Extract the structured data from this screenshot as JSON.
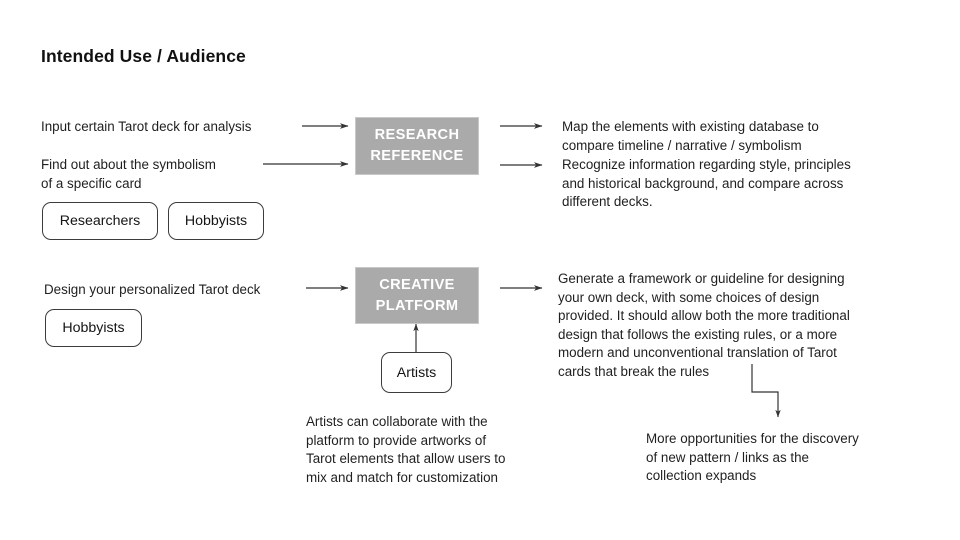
{
  "page": {
    "title": "Intended Use / Audience",
    "background_color": "#ffffff",
    "text_color": "#1f1f1f",
    "box_fill_color": "#aaaaaa",
    "box_border_color": "#c9c9c9",
    "box_text_color": "#ffffff",
    "connector_color": "#333333"
  },
  "flows": [
    {
      "id": "research-reference",
      "inputs": [
        {
          "id": "input-1",
          "text": "Input certain Tarot deck for analysis"
        },
        {
          "id": "input-2",
          "text": "Find out about the symbolism\nof a specific card"
        }
      ],
      "actors": [
        {
          "id": "actor-researchers",
          "label": "Researchers"
        },
        {
          "id": "actor-hobbyists",
          "label": "Hobbyists"
        }
      ],
      "process": {
        "id": "process-research-reference",
        "label": "RESEARCH\nREFERENCE"
      },
      "outputs": [
        {
          "id": "output-1",
          "text": "Map the elements with existing database to\ncompare timeline / narrative / symbolism"
        },
        {
          "id": "output-2",
          "text": "Recognize information regarding style, principles\nand historical background, and compare across\ndifferent decks."
        }
      ]
    },
    {
      "id": "creative-platform",
      "inputs": [
        {
          "id": "input-3",
          "text": "Design your personalized Tarot deck"
        }
      ],
      "actors": [
        {
          "id": "actor-hobbyists-2",
          "label": "Hobbyists"
        }
      ],
      "process": {
        "id": "process-creative-platform",
        "label": "CREATIVE\nPLATFORM"
      },
      "outputs": [
        {
          "id": "output-3",
          "text": "Generate a framework or guideline for designing\nyour own deck, with some choices of design\nprovided. It should allow both the more traditional\ndesign that follows the existing rules, or a more\nmodern and unconventional translation of Tarot\ncards that break the rules"
        }
      ],
      "contributor": {
        "id": "actor-artists",
        "label": "Artists",
        "note": "Artists can collaborate with the\nplatform to provide artworks of\nTarot elements that allow users to\nmix and match for customization"
      },
      "downstream": {
        "id": "outcome-discovery",
        "text": "More opportunities for the discovery\nof new pattern / links  as the\ncollection expands"
      }
    }
  ]
}
